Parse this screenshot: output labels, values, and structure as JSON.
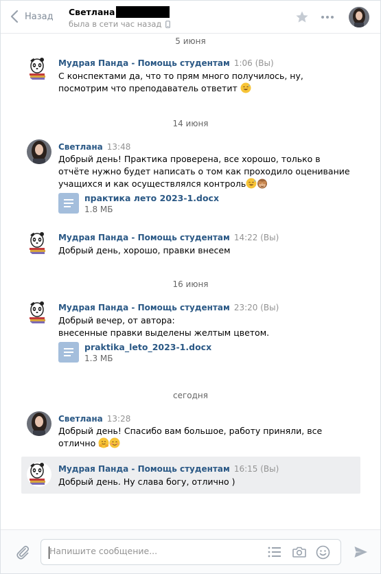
{
  "header": {
    "back_label": "Назад",
    "peer_name": "Светлана",
    "peer_status": "была в сети час назад"
  },
  "dates": [
    "5 июня",
    "14 июня",
    "16 июня",
    "сегодня"
  ],
  "messages": [
    {
      "author": "Мудрая Панда - Помощь студентам",
      "time": "1:06 (Вы)",
      "lines": [
        "С конспектами да, что то прям много получилось, ну,",
        "посмотрим что преподаватель ответит"
      ]
    },
    {
      "author": "Светлана",
      "time": "13:48",
      "lines": [
        "Добрый день! Практика проверена, все хорошо, только в",
        "отчёте нужно будет написать о том как проходило оценивание",
        "учащихся и как осуществлялся контроль"
      ],
      "doc": {
        "name": "практика лето 2023-1.docx",
        "size": "1.8 МБ"
      }
    },
    {
      "author": "Мудрая Панда - Помощь студентам",
      "time": "14:22 (Вы)",
      "lines": [
        "Добрый день, хорошо, правки внесем"
      ]
    },
    {
      "author": "Мудрая Панда - Помощь студентам",
      "time": "23:20 (Вы)",
      "lines": [
        "Добрый вечер, от автора:",
        "внесенные правки выделены желтым цветом."
      ],
      "doc": {
        "name": "praktika_leto_2023-1.docx",
        "size": "1.3 МБ"
      }
    },
    {
      "author": "Светлана",
      "time": "13:28",
      "lines": [
        "Добрый день! Спасибо вам большое, работу приняли, все",
        "отлично"
      ]
    },
    {
      "author": "Мудрая Панда - Помощь студентам",
      "time": "16:15 (Вы)",
      "lines": [
        "Добрый день. Ну слава богу, отлично )"
      ]
    }
  ],
  "composer": {
    "placeholder": "Напишите сообщение..."
  },
  "colors": {
    "link": "#2a5885",
    "muted": "#939393",
    "highlight": "#edeef0",
    "doc_icon": "#7ea3ce"
  }
}
